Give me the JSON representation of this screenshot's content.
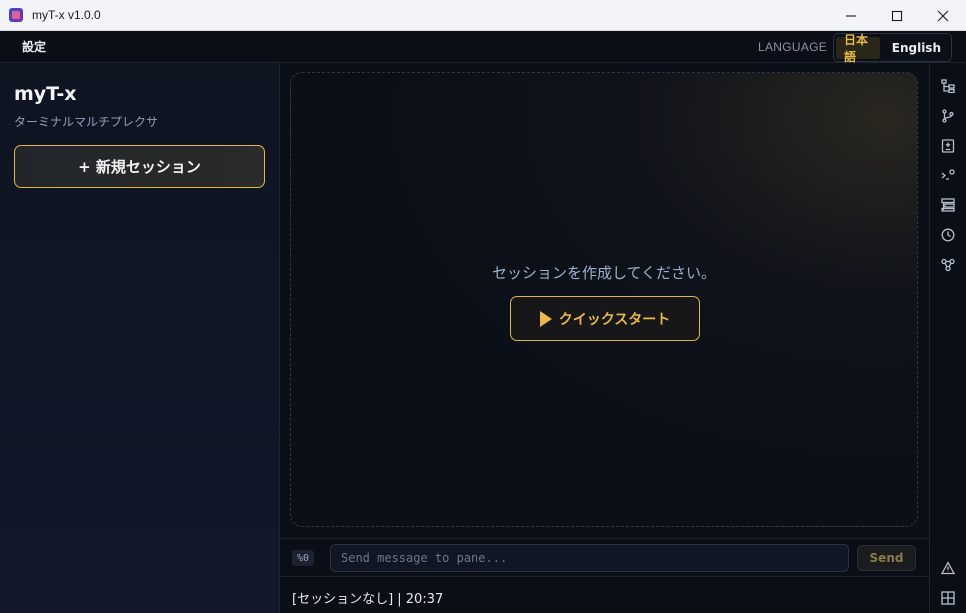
{
  "window": {
    "title": "myT-x v1.0.0"
  },
  "menubar": {
    "settings_label": "設定",
    "language_label": "LANGUAGE",
    "languages": [
      {
        "label": "日本語",
        "active": true
      },
      {
        "label": "English",
        "active": false
      }
    ]
  },
  "sidebar": {
    "brand": "myT-x",
    "subtitle": "ターミナルマルチプレクサ",
    "new_session_label": "+ 新規セッション"
  },
  "main": {
    "empty_message": "セッションを作成してください。",
    "quick_start_label": "クイックスタート"
  },
  "input_bar": {
    "pane_badge": "%0",
    "placeholder": "Send message to pane...",
    "value": "",
    "send_label": "Send"
  },
  "status_bar": {
    "text": "[セッションなし] | 20:37"
  },
  "right_toolbar": {
    "icons": [
      "file-tree-icon",
      "git-branch-icon",
      "file-diff-icon",
      "terminal-icon",
      "layout-icon",
      "history-icon",
      "agents-icon",
      "warning-icon",
      "grid-icon"
    ]
  },
  "colors": {
    "accent": "#e1b44a",
    "background": "#0c1019",
    "sidebar": "#0f1421"
  }
}
